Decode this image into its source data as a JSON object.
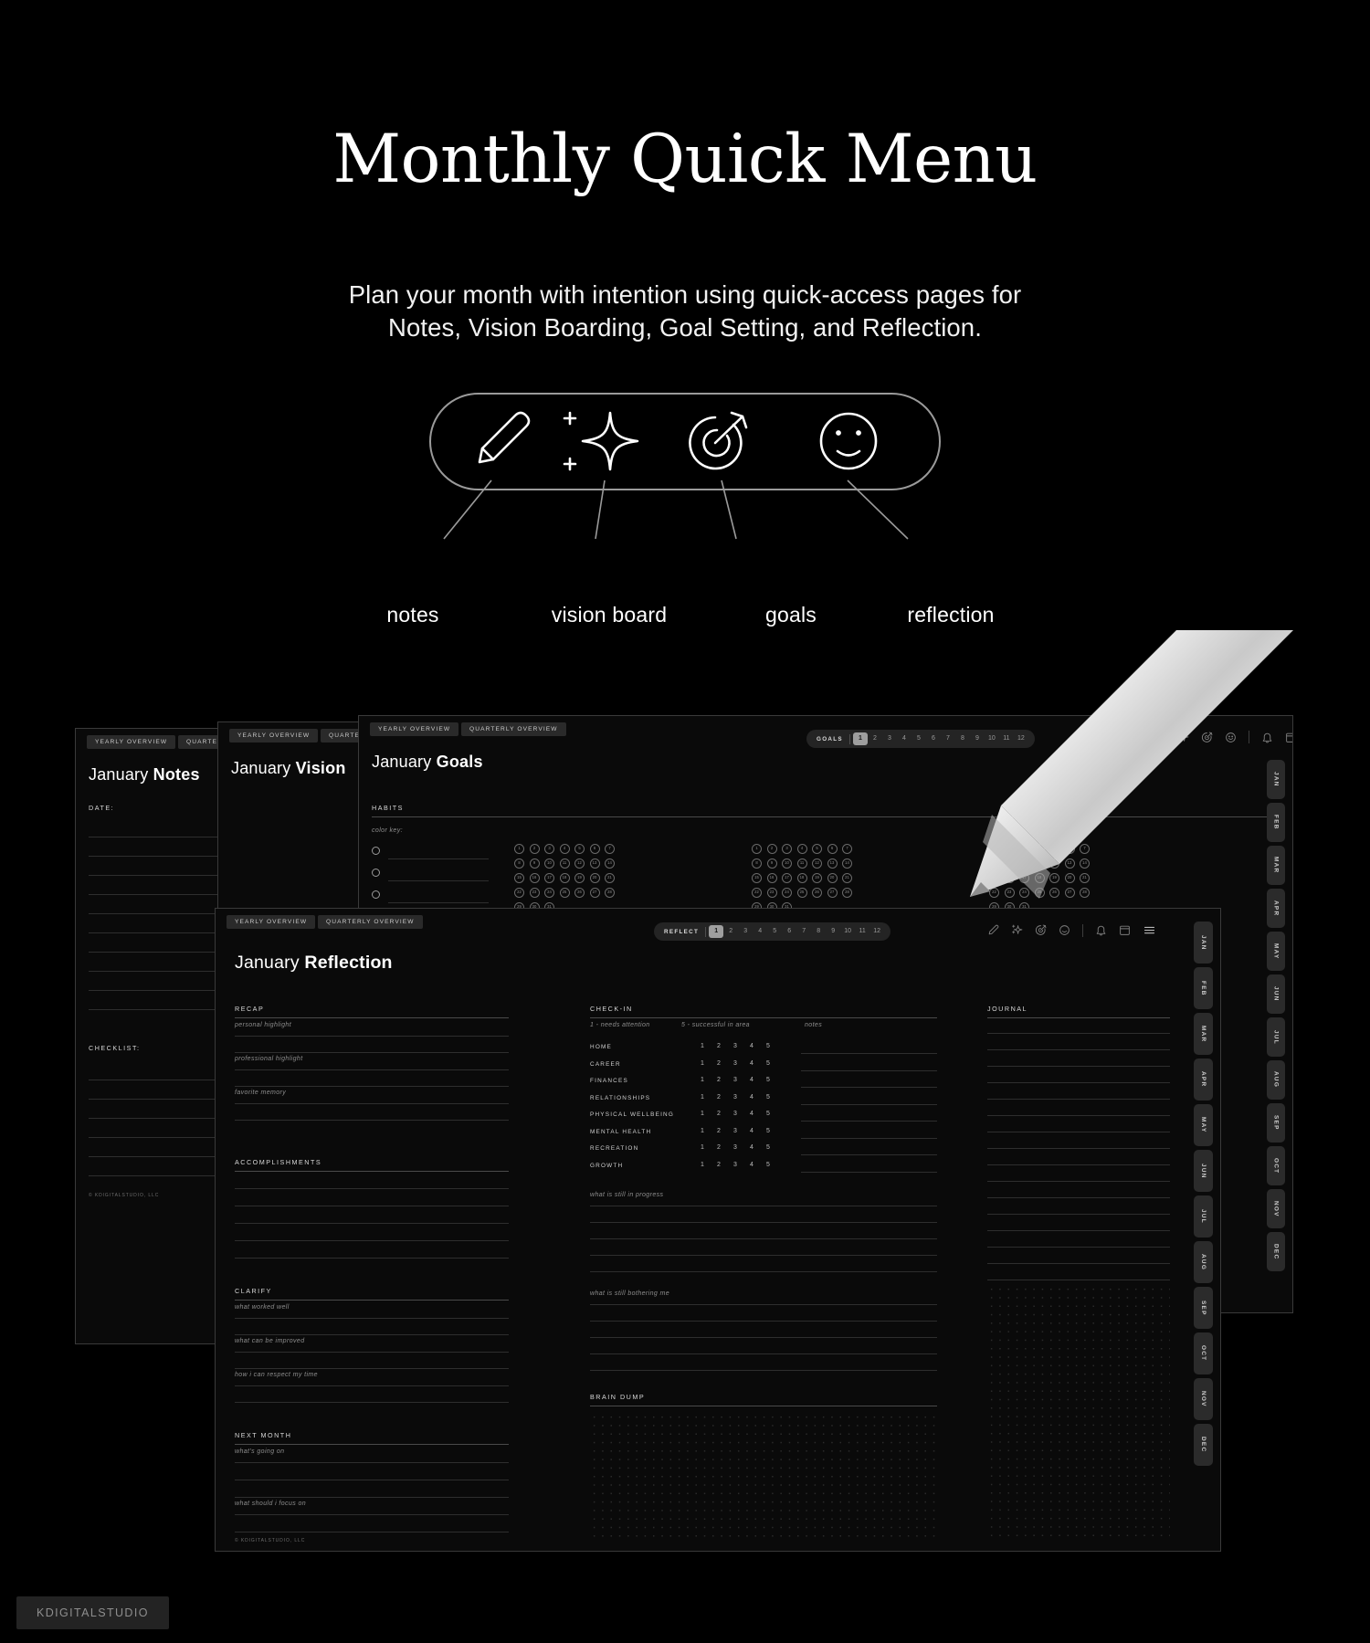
{
  "hero": {
    "title": "Monthly Quick Menu",
    "subtitle_line1": "Plan your month with intention using quick-access pages for",
    "subtitle_line2": "Notes, Vision Boarding, Goal Setting, and Reflection."
  },
  "icon_menu": {
    "items": [
      {
        "icon": "pencil-icon",
        "label": "notes"
      },
      {
        "icon": "sparkle-icon",
        "label": "vision board"
      },
      {
        "icon": "target-arrow-icon",
        "label": "goals"
      },
      {
        "icon": "smiley-face-icon",
        "label": "reflection"
      }
    ]
  },
  "nav_buttons": {
    "yearly_overview": "YEARLY OVERVIEW",
    "quarterly_overview": "QUARTERLY OVERVIEW"
  },
  "pages": {
    "notes": {
      "title_month": "January",
      "title_bold": "Notes",
      "date_label": "DATE:",
      "checklist_label": "CHECKLIST:",
      "footer": "© KDIGITALSTUDIO, LLC"
    },
    "vision": {
      "title_month": "January",
      "title_bold": "Vision"
    },
    "goals": {
      "title_month": "January",
      "title_bold": "Goals",
      "habits_label": "HABITS",
      "color_key_label": "color key:",
      "nav_label": "GOALS",
      "nav_pages": [
        "1",
        "2",
        "3",
        "4",
        "5",
        "6",
        "7",
        "8",
        "9",
        "10",
        "11",
        "12"
      ],
      "nav_active": "1"
    },
    "reflection": {
      "title_month": "January",
      "title_bold": "Reflection",
      "nav_label": "REFLECT",
      "nav_pages": [
        "1",
        "2",
        "3",
        "4",
        "5",
        "6",
        "7",
        "8",
        "9",
        "10",
        "11",
        "12"
      ],
      "nav_active": "1",
      "recap": {
        "heading": "RECAP",
        "fields": [
          "personal highlight",
          "professional highlight",
          "favorite memory"
        ]
      },
      "accomplishments": {
        "heading": "ACCOMPLISHMENTS"
      },
      "clarify": {
        "heading": "CLARIFY",
        "fields": [
          "what worked well",
          "what can be improved",
          "how i can respect my time"
        ]
      },
      "next_month": {
        "heading": "NEXT MONTH",
        "fields": [
          "what's going on",
          "what should i focus on"
        ]
      },
      "checkin": {
        "heading": "CHECK-IN",
        "scale_low": "1 - needs attention",
        "scale_high": "5 - successful in area",
        "notes_label": "notes",
        "scale_values": [
          "1",
          "2",
          "3",
          "4",
          "5"
        ],
        "areas": [
          "HOME",
          "CAREER",
          "FINANCES",
          "RELATIONSHIPS",
          "PHYSICAL WELLBEING",
          "MENTAL HEALTH",
          "RECREATION",
          "GROWTH"
        ],
        "prompt_in_progress": "what is still in progress",
        "prompt_bothering": "what is still bothering me",
        "brain_dump_heading": "BRAIN DUMP"
      },
      "journal": {
        "heading": "JOURNAL"
      },
      "footer": "© KDIGITALSTUDIO, LLC"
    }
  },
  "month_tabs": [
    "JAN",
    "FEB",
    "MAR",
    "APR",
    "MAY",
    "JUN",
    "JUL",
    "AUG",
    "SEP",
    "OCT",
    "NOV",
    "DEC"
  ],
  "watermark": "KDIGITALSTUDIO",
  "colors": {
    "background": "#000000",
    "page_surface": "#0a0a0a",
    "page_border": "#3a3a3a",
    "chip": "#2a2a2a",
    "text_primary": "#ffffff",
    "text_muted": "#8e8e8e",
    "rule": "#4a4a4a",
    "active_chip": "#9e9e9e"
  }
}
